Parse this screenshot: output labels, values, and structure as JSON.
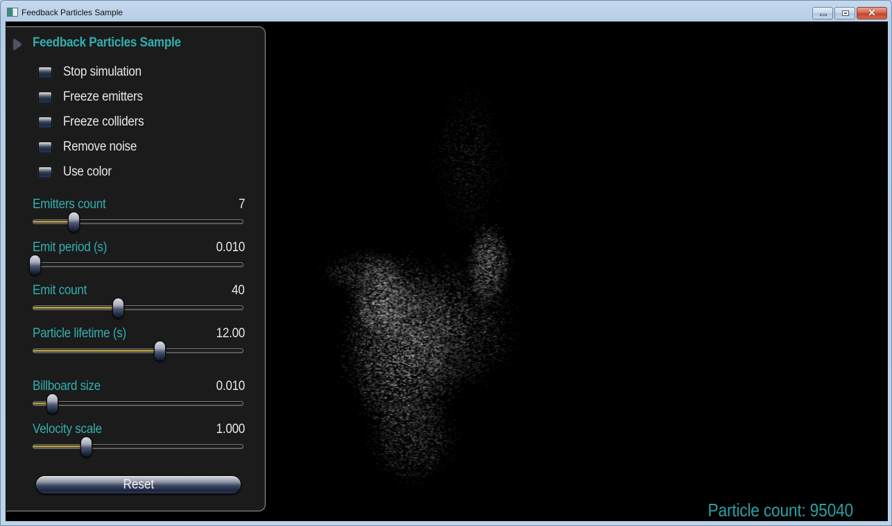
{
  "window": {
    "title": "Feedback Particles Sample",
    "controls": [
      "minimize",
      "maximize",
      "close"
    ]
  },
  "panel": {
    "title": "Feedback Particles Sample",
    "expand_icon": "triangle-right-icon",
    "checkboxes": [
      {
        "label": "Stop simulation",
        "checked": false
      },
      {
        "label": "Freeze emitters",
        "checked": false
      },
      {
        "label": "Freeze colliders",
        "checked": false
      },
      {
        "label": "Remove noise",
        "checked": false
      },
      {
        "label": "Use color",
        "checked": false
      }
    ],
    "sliders": [
      {
        "label": "Emitters count",
        "value": "7",
        "fill_fraction": 0.19
      },
      {
        "label": "Emit period (s)",
        "value": "0.010",
        "fill_fraction": 0.0
      },
      {
        "label": "Emit count",
        "value": "40",
        "fill_fraction": 0.4
      },
      {
        "label": "Particle lifetime (s)",
        "value": "12.00",
        "fill_fraction": 0.6
      },
      {
        "label": "Billboard size",
        "value": "0.010",
        "fill_fraction": 0.09
      },
      {
        "label": "Velocity scale",
        "value": "1.000",
        "fill_fraction": 0.25
      }
    ],
    "reset_label": "Reset"
  },
  "viewport": {
    "particle_count_text": "Particle count: 95040"
  },
  "colors": {
    "accent": "#33aeb0",
    "slider_fill": "#b09a44",
    "panel_bg": "#1b1b1b",
    "viewport_bg": "#000000"
  }
}
